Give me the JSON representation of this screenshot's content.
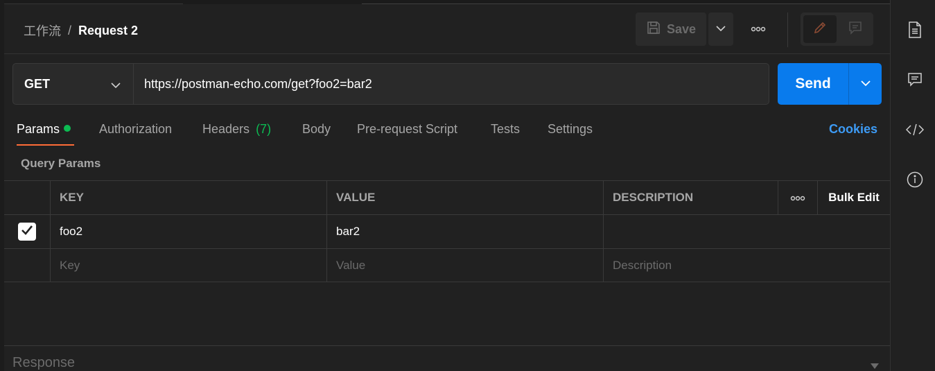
{
  "header": {
    "breadcrumb_parent": "工作流",
    "breadcrumb_separator": "/",
    "breadcrumb_current": "Request 2",
    "save_label": "Save"
  },
  "request": {
    "method": "GET",
    "url": "https://postman-echo.com/get?foo2=bar2",
    "send_label": "Send"
  },
  "tabs": {
    "params": "Params",
    "authorization": "Authorization",
    "headers": "Headers",
    "headers_count": "(7)",
    "body": "Body",
    "prerequest": "Pre-request Script",
    "tests": "Tests",
    "settings": "Settings",
    "cookies": "Cookies"
  },
  "params": {
    "section_title": "Query Params",
    "columns": {
      "key": "KEY",
      "value": "VALUE",
      "description": "DESCRIPTION",
      "bulk_edit": "Bulk Edit"
    },
    "rows": [
      {
        "key": "foo2",
        "value": "bar2",
        "description": "",
        "checked": true
      }
    ],
    "placeholders": {
      "key": "Key",
      "value": "Value",
      "description": "Description"
    }
  },
  "response": {
    "label": "Response"
  },
  "colors": {
    "accent_blue": "#097bed",
    "active_tab_underline": "#ff6c37",
    "status_green": "#0cbb52",
    "link_blue": "#3d9bf5"
  },
  "icons": [
    "save-icon",
    "chevron-down-icon",
    "more-icon",
    "edit-pencil-icon",
    "comment-icon",
    "documentation-icon",
    "comments-icon",
    "code-icon",
    "info-icon",
    "checkmark-icon"
  ]
}
